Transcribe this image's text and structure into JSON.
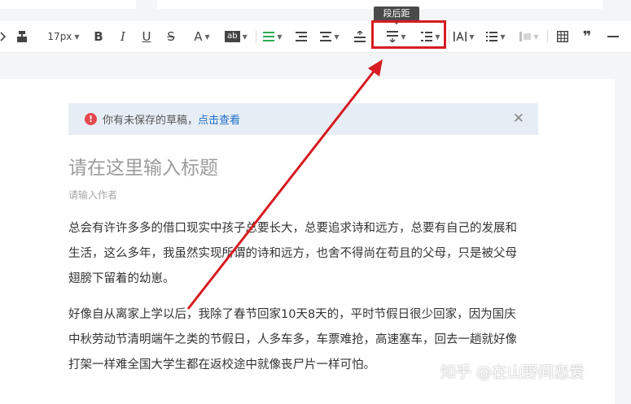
{
  "toolbar": {
    "font_size": "17px",
    "bold": "B",
    "italic": "I",
    "underline": "U",
    "strike": "S",
    "font_color": "A",
    "highlight": "ab",
    "quote": "❞"
  },
  "tooltip": {
    "label": "段后距"
  },
  "notice": {
    "message": "你有未保存的草稿，",
    "link": "点击查看"
  },
  "article": {
    "title_placeholder": "请在这里输入标题",
    "author_placeholder": "请输入作者",
    "paragraphs": [
      {
        "lines": [
          "总会有许许多多的借口现实中孩子总要长大，总要追求诗和远方，总要有自己的发展和",
          "生活，这么多年，我虽然实现所谓的诗和远方，也舍不得尚在苟且的父母，只是被父母",
          "翅膀下留着的幼崽。"
        ]
      },
      {
        "lines": [
          "好像自从离家上学以后，我除了春节回家10天8天的，平时节假日很少回家，因为国庆",
          "中秋劳动节清明端午之类的节假日，人多车多，车票难抢，高速塞车，回去一趟就好像",
          "打架一样难全国大学生都在返校途中就像丧尸片一样可怕。"
        ]
      }
    ]
  },
  "watermark": "知乎 @在山野间恋爱",
  "colors": {
    "highlight_red": "#d61c22",
    "notice_bg": "#e6edf5",
    "link_blue": "#1e6fc8",
    "warn_red": "#e5484d"
  }
}
